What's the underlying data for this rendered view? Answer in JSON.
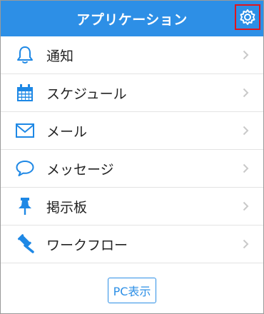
{
  "header": {
    "title": "アプリケーション",
    "settings_icon": "gear-icon"
  },
  "menu": {
    "items": [
      {
        "label": "通知",
        "icon": "bell-icon"
      },
      {
        "label": "スケジュール",
        "icon": "calendar-icon"
      },
      {
        "label": "メール",
        "icon": "envelope-icon"
      },
      {
        "label": "メッセージ",
        "icon": "speech-bubble-icon"
      },
      {
        "label": "掲示板",
        "icon": "pushpin-icon"
      },
      {
        "label": "ワークフロー",
        "icon": "gavel-icon"
      }
    ]
  },
  "footer": {
    "pc_view_label": "PC表示"
  },
  "colors": {
    "accent": "#2d8fe6",
    "highlight_border": "#e0151d",
    "icon": "#1e88e5"
  }
}
